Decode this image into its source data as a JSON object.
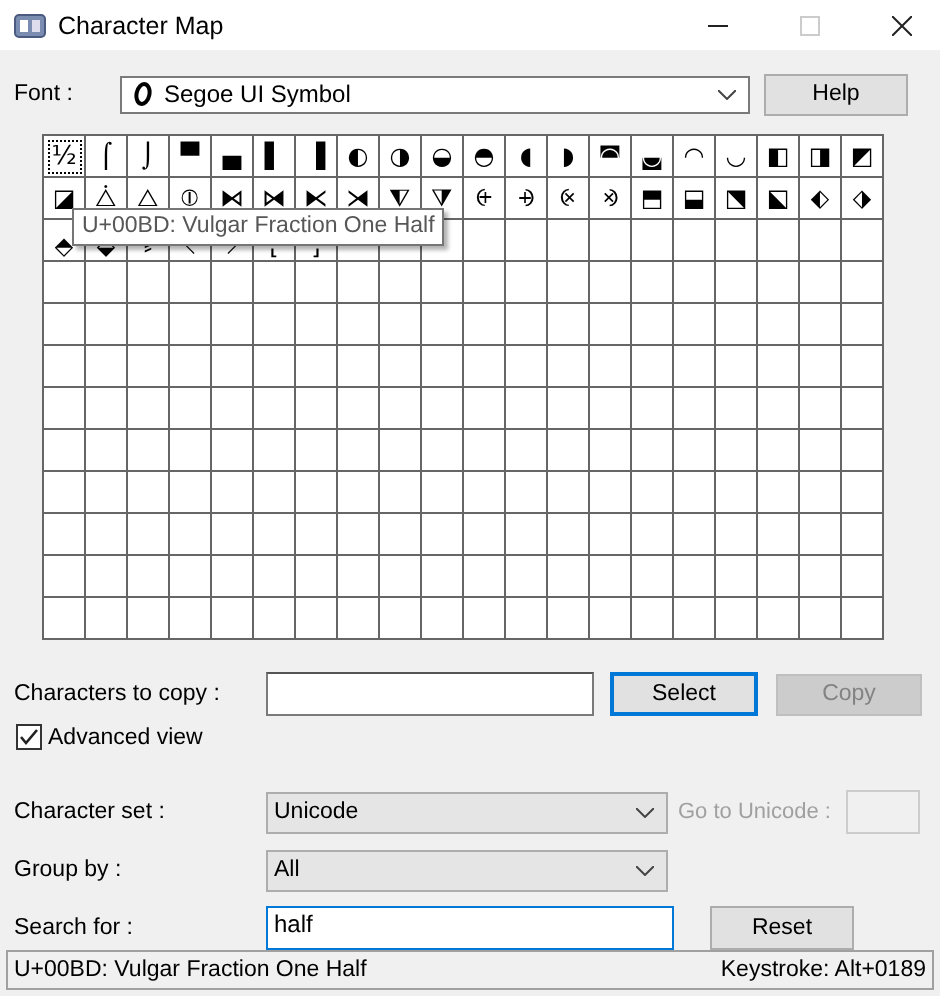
{
  "window": {
    "title": "Character Map"
  },
  "font": {
    "label": "Font :",
    "value": "Segoe UI Symbol",
    "button": "Help"
  },
  "grid": {
    "cells": [
      {
        "char": "½",
        "selected": true
      },
      {
        "char": "⌠",
        "selected": false
      },
      {
        "char": "⌡",
        "selected": false
      },
      {
        "char": "▀",
        "selected": false
      },
      {
        "char": "▄",
        "selected": false
      },
      {
        "char": "▌",
        "selected": false
      },
      {
        "char": "▐",
        "selected": false
      },
      {
        "char": "◐",
        "selected": false
      },
      {
        "char": "◑",
        "selected": false
      },
      {
        "char": "◒",
        "selected": false
      },
      {
        "char": "◓",
        "selected": false
      },
      {
        "char": "◖",
        "selected": false
      },
      {
        "char": "◗",
        "selected": false
      },
      {
        "char": "◚",
        "selected": false
      },
      {
        "char": "◛",
        "selected": false
      },
      {
        "char": "◠",
        "selected": false
      },
      {
        "char": "◡",
        "selected": false
      },
      {
        "char": "◧",
        "selected": false
      },
      {
        "char": "◨",
        "selected": false
      },
      {
        "char": "◩",
        "selected": false
      },
      {
        "char": "◪",
        "selected": false
      },
      {
        "char": "⧊",
        "selected": false
      },
      {
        "char": "⧋",
        "selected": false
      },
      {
        "char": "⦶",
        "selected": false
      },
      {
        "char": "⧑",
        "selected": false
      },
      {
        "char": "⧒",
        "selected": false
      },
      {
        "char": "⧔",
        "selected": false
      },
      {
        "char": "⧕",
        "selected": false
      },
      {
        "char": "⧨",
        "selected": false
      },
      {
        "char": "⧩",
        "selected": false
      },
      {
        "char": "⨭",
        "selected": false
      },
      {
        "char": "⨮",
        "selected": false
      },
      {
        "char": "⨴",
        "selected": false
      },
      {
        "char": "⨵",
        "selected": false
      },
      {
        "char": "⬒",
        "selected": false
      },
      {
        "char": "⬓",
        "selected": false
      },
      {
        "char": "⬔",
        "selected": false
      },
      {
        "char": "⬕",
        "selected": false
      },
      {
        "char": "⬖",
        "selected": false
      },
      {
        "char": "⬗",
        "selected": false
      },
      {
        "char": "⬘",
        "selected": false
      },
      {
        "char": "⬙",
        "selected": false
      },
      {
        "char": "⸗",
        "selected": false
      },
      {
        "char": "⸜",
        "selected": false
      },
      {
        "char": "⸝",
        "selected": false
      },
      {
        "char": "⸤",
        "selected": false
      },
      {
        "char": "⸥",
        "selected": false
      }
    ],
    "tooltip": "U+00BD: Vulgar Fraction One Half"
  },
  "copy": {
    "label": "Characters to copy :",
    "select": {
      "label": "Select",
      "focused": true
    },
    "copy": {
      "label": "Copy",
      "disabled": true
    }
  },
  "advanced": {
    "label": "Advanced view",
    "checked": true
  },
  "charset": {
    "label": "Character set :",
    "value": "Unicode",
    "goto_label": "Go to Unicode :",
    "goto_disabled": true
  },
  "group": {
    "label": "Group by :",
    "value": "All"
  },
  "search": {
    "label": "Search for :",
    "value": "half",
    "button": "Reset"
  },
  "status_bar": {
    "name": "U+00BD: Vulgar Fraction One Half",
    "keystroke": "Keystroke: Alt+0189"
  }
}
